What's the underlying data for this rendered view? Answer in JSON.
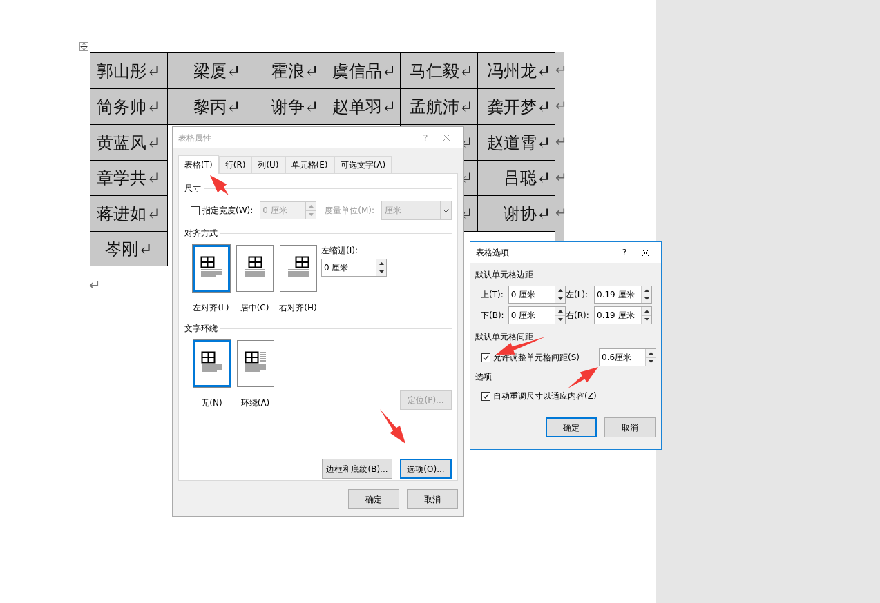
{
  "document": {
    "table": {
      "rows": [
        {
          "cells": [
            "郭山彤↵",
            "梁厦↵",
            "霍浪↵",
            "虞信品↵",
            "马仁毅↵",
            "冯州龙↵"
          ],
          "row_end": "↵"
        },
        {
          "cells": [
            "简务帅↵",
            "黎丙↵",
            "谢争↵",
            "赵单羽↵",
            "孟航沛↵",
            "龚开梦↵"
          ],
          "row_end": "↵"
        },
        {
          "cells": [
            "黄蓝风↵",
            null,
            null,
            null,
            "↵",
            "赵道霄↵"
          ],
          "row_end": "↵"
        },
        {
          "cells": [
            "章学共↵",
            null,
            null,
            null,
            "↵",
            "吕聪↵"
          ],
          "row_end": "↵"
        },
        {
          "cells": [
            "蒋进如↵",
            null,
            null,
            null,
            "↵",
            "谢协↵"
          ],
          "row_end": "↵"
        },
        {
          "cells": [
            "岑刚↵",
            null,
            null,
            null,
            null,
            null
          ]
        }
      ]
    },
    "paragraph_mark": "↵"
  },
  "table_properties": {
    "title": "表格属性",
    "help": "?",
    "tabs": [
      {
        "label": "表格(T)",
        "selected": true
      },
      {
        "label": "行(R)",
        "selected": false
      },
      {
        "label": "列(U)",
        "selected": false
      },
      {
        "label": "单元格(E)",
        "selected": false
      },
      {
        "label": "可选文字(A)",
        "selected": false
      }
    ],
    "size": {
      "heading": "尺寸",
      "preferred_width": {
        "label": "指定宽度(W):",
        "checked": false
      },
      "width_value": "0 厘米",
      "unit_label": "度量单位(M):",
      "unit_value": "厘米"
    },
    "alignment": {
      "heading": "对齐方式",
      "options": [
        {
          "label": "左对齐(L)",
          "kind": "left",
          "selected": true
        },
        {
          "label": "居中(C)",
          "kind": "center",
          "selected": false
        },
        {
          "label": "右对齐(H)",
          "kind": "right",
          "selected": false
        }
      ],
      "indent_label": "左缩进(I):",
      "indent_value": "0 厘米"
    },
    "wrapping": {
      "heading": "文字环绕",
      "options": [
        {
          "label": "无(N)",
          "kind": "none",
          "selected": true
        },
        {
          "label": "环绕(A)",
          "kind": "around",
          "selected": false
        }
      ],
      "position_button": {
        "label": "定位(P)...",
        "disabled": true
      }
    },
    "panel_buttons": [
      {
        "label": "边框和底纹(B)...",
        "focused": false
      },
      {
        "label": "选项(O)...",
        "focused": true
      }
    ],
    "buttons": [
      {
        "label": "确定"
      },
      {
        "label": "取消"
      }
    ]
  },
  "table_options": {
    "title": "表格选项",
    "help": "?",
    "margins": {
      "heading": "默认单元格边距",
      "fields": [
        {
          "label": "上(T):",
          "value": "0 厘米"
        },
        {
          "label": "左(L):",
          "value": "0.19 厘米"
        },
        {
          "label": "下(B):",
          "value": "0 厘米"
        },
        {
          "label": "右(R):",
          "value": "0.19 厘米"
        }
      ]
    },
    "spacing": {
      "heading": "默认单元格间距",
      "allow": {
        "label": "允许调整单元格间距(S)",
        "checked": true
      },
      "value": "0.6厘米"
    },
    "options": {
      "heading": "选项",
      "autofit": {
        "label": "自动重调尺寸以适应内容(Z)",
        "checked": true
      }
    },
    "buttons": [
      {
        "label": "确定",
        "focused": true
      },
      {
        "label": "取消",
        "focused": false
      }
    ]
  }
}
